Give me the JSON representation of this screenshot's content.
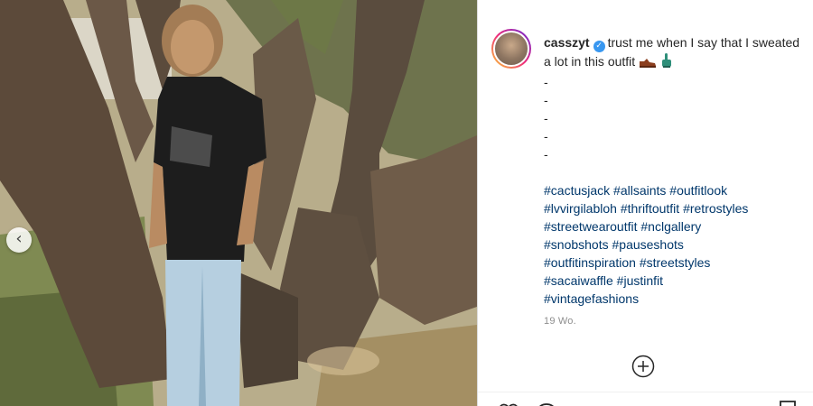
{
  "post": {
    "username": "casszyt",
    "caption_text": "trust me when I say that I sweated a lot in this outfit",
    "caption_emojis": [
      "shoe-emoji",
      "hand-pointing-emoji"
    ],
    "dash_lines": [
      "-",
      "-",
      "-",
      "-",
      "-"
    ],
    "hashtag_lines": [
      "#cactusjack #allsaints #outfitlook",
      "#lvvirgilabloh #thriftoutfit #retrostyles",
      "#streetwearoutfit #nclgallery",
      "#snobshots #pauseshots",
      "#outfitinspiration #streetstyles",
      "#sacaiwaffle #justinfit",
      "#vintagefashions"
    ],
    "time_ago": "19 Wo."
  },
  "icons": {
    "verified": "verified-badge-icon",
    "prev": "chevron-left-icon",
    "add": "plus-circle-icon"
  },
  "colors": {
    "hashtag": "#00376b",
    "verified": "#3897f0",
    "text": "#262626",
    "muted": "#8e8e8e"
  }
}
